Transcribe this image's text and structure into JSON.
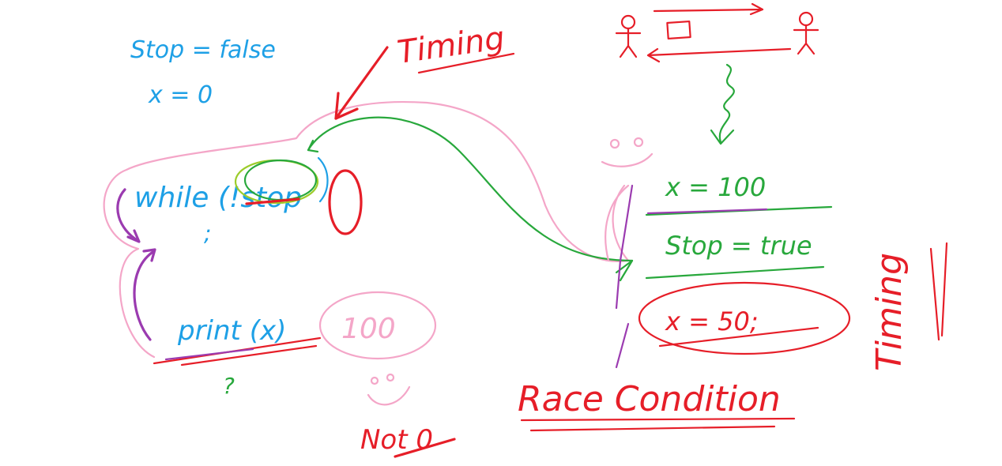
{
  "init": {
    "stop_line": "Stop = false",
    "x_line": "x = 0"
  },
  "loop": {
    "while_code": "while (!stop",
    "semicolon": ";",
    "print_code": "print (x)",
    "question": "?",
    "print_value": "100",
    "not_zero": "Not 0"
  },
  "labels": {
    "timing_top": "Timing",
    "timing_right": "Timing",
    "race_condition": "Race Condition"
  },
  "thread2": {
    "x_assign": "x = 100",
    "stop_assign": "Stop = true",
    "x_assign_50": "x = 50;"
  },
  "colors": {
    "blue": "#1ea0e6",
    "red": "#e61e28",
    "green": "#28a83c",
    "pink": "#f4a6c8",
    "purple": "#9b3bb0"
  }
}
